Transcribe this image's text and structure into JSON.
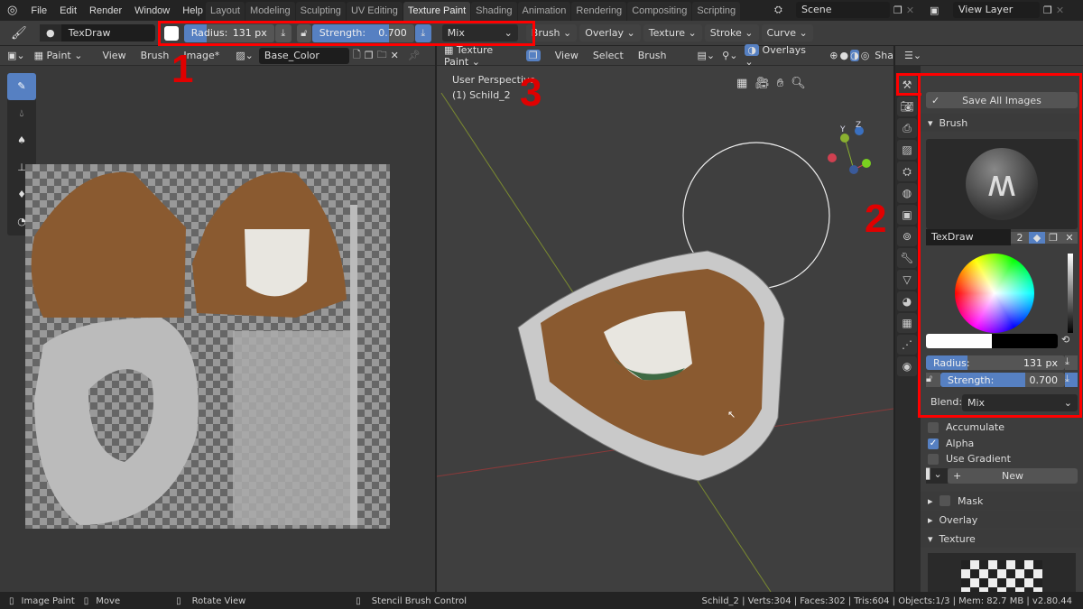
{
  "topbar": {
    "menus": [
      "File",
      "Edit",
      "Render",
      "Window",
      "Help"
    ],
    "workspaces": [
      "Layout",
      "Modeling",
      "Sculpting",
      "UV Editing",
      "Texture Paint",
      "Shading",
      "Animation",
      "Rendering",
      "Compositing",
      "Scripting"
    ],
    "active_workspace": "Texture Paint",
    "scene": "Scene",
    "view_layer": "View Layer"
  },
  "toolheader": {
    "brush_name": "TexDraw",
    "radius_label": "Radius:",
    "radius_value": "131 px",
    "radius_fraction": 0.25,
    "strength_label": "Strength:",
    "strength_value": "0.700",
    "strength_fraction": 0.7,
    "blend": "Mix",
    "menus": [
      "Brush",
      "Overlay",
      "Texture",
      "Stroke",
      "Curve"
    ]
  },
  "image_editor": {
    "mode": "Paint",
    "menus": [
      "View",
      "Brush",
      "Image*"
    ],
    "image_name": "Base_Color",
    "tools": [
      "brush-icon",
      "soften-icon",
      "smear-icon",
      "clone-icon",
      "fill-icon",
      "mask-icon"
    ]
  },
  "viewport": {
    "mode": "Texture Paint",
    "menus": [
      "View",
      "Select",
      "Brush"
    ],
    "overlays": "Overlays",
    "shading_cut": "Sha",
    "perspective": "User Perspective",
    "object": "(1) Schild_2",
    "gizmo_axes": [
      "X",
      "Y",
      "Z"
    ]
  },
  "properties": {
    "save_all": "Save All Images",
    "brush_panel": "Brush",
    "brush_name": "TexDraw",
    "brush_users": "2",
    "radius_label": "Radius:",
    "radius_value": "131 px",
    "strength_label": "Strength:",
    "strength_value": "0.700",
    "blend_label": "Blend:",
    "blend_value": "Mix",
    "options": [
      {
        "label": "Accumulate",
        "checked": false
      },
      {
        "label": "Alpha",
        "checked": true
      },
      {
        "label": "Use Gradient",
        "checked": false
      }
    ],
    "new_label": "New",
    "panels": [
      "Mask",
      "Overlay",
      "Texture"
    ]
  },
  "annotations": {
    "one": "1",
    "two": "2",
    "three": "3",
    "color": "#ff0000"
  },
  "statusbar": {
    "hints": [
      "Image Paint",
      "Move",
      "Rotate View",
      "Stencil Brush Control"
    ],
    "info": "Schild_2 | Verts:304 | Faces:302 | Tris:604 | Objects:1/3 | Mem: 82.7 MB | v2.80.44"
  }
}
